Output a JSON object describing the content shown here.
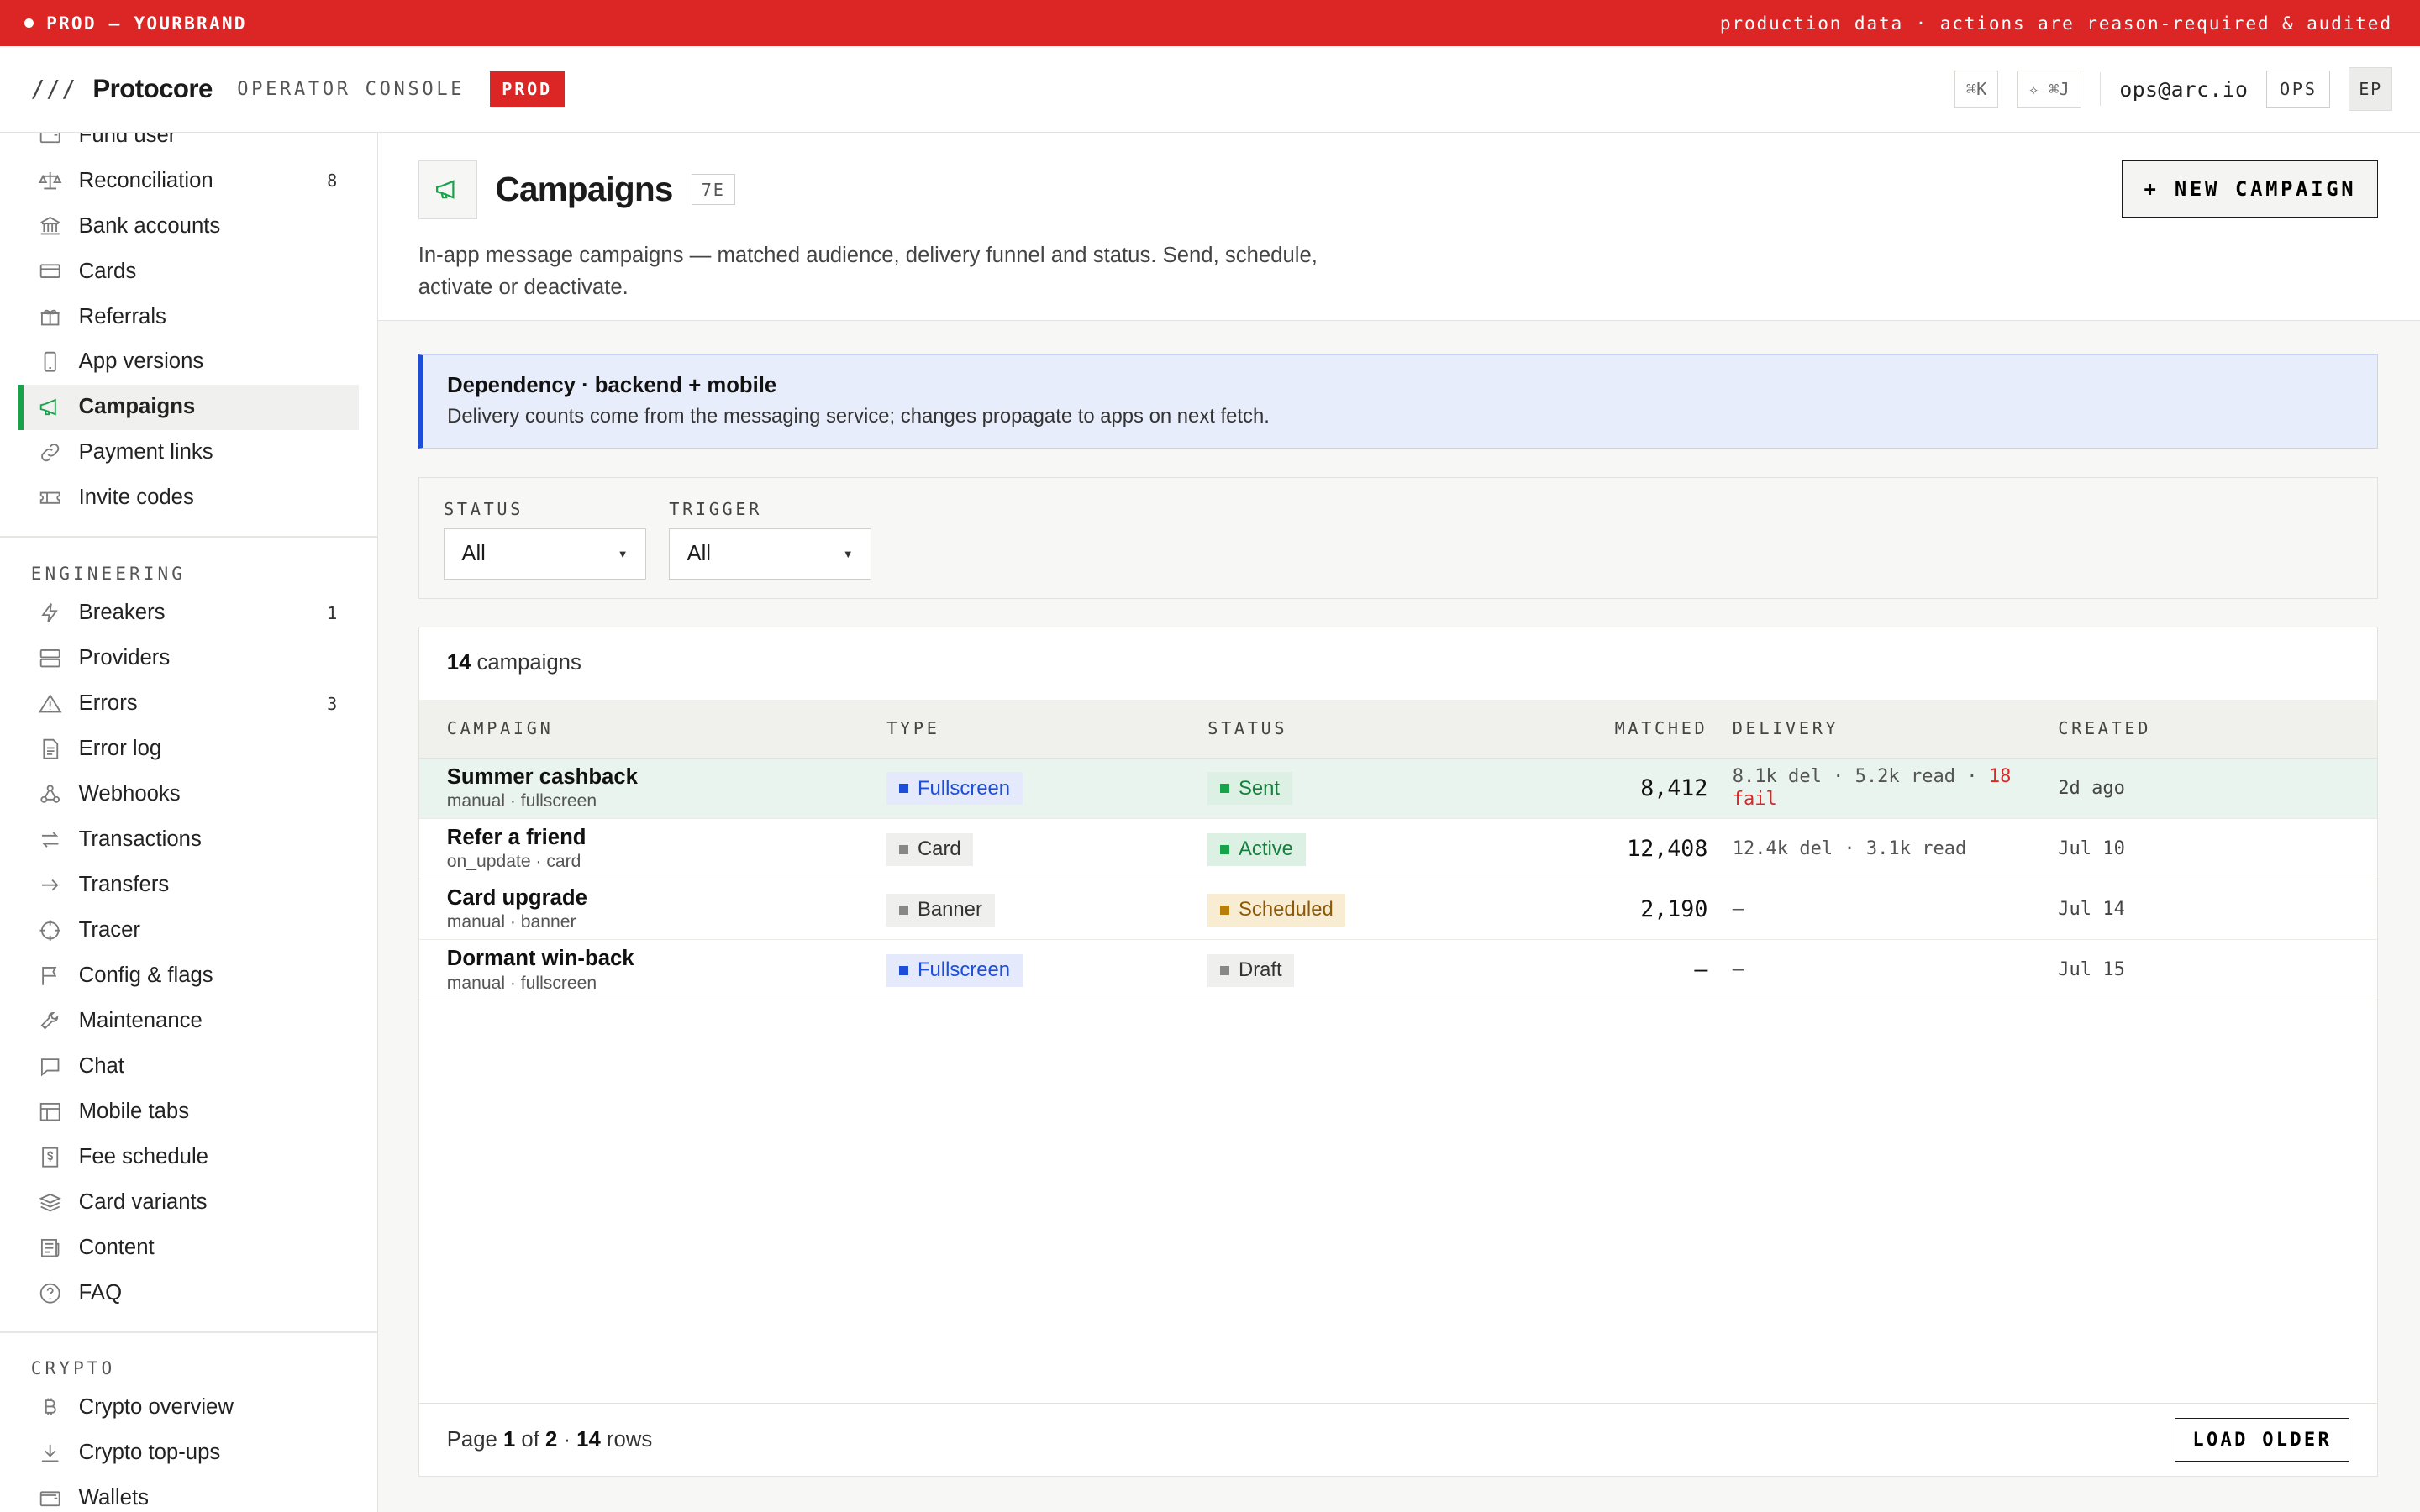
{
  "banner": {
    "left": "PROD — YOURBRAND",
    "right": "production data · actions are reason-required & audited"
  },
  "header": {
    "slashes": "///",
    "brand": "Protocore",
    "console": "OPERATOR CONSOLE",
    "env_pill": "PROD",
    "kbd_search": "⌘K",
    "kbd_jump": "✧ ⌘J",
    "email": "ops@arc.io",
    "role": "OPS",
    "avatar": "EP"
  },
  "sidebar": {
    "top_items": [
      {
        "label": "Fund user",
        "icon": "wallet-icon",
        "count": ""
      },
      {
        "label": "Reconciliation",
        "icon": "scale-icon",
        "count": "8"
      },
      {
        "label": "Bank accounts",
        "icon": "bank-icon",
        "count": ""
      },
      {
        "label": "Cards",
        "icon": "card-icon",
        "count": ""
      },
      {
        "label": "Referrals",
        "icon": "gift-icon",
        "count": ""
      },
      {
        "label": "App versions",
        "icon": "phone-icon",
        "count": ""
      },
      {
        "label": "Campaigns",
        "icon": "megaphone-icon",
        "count": ""
      },
      {
        "label": "Payment links",
        "icon": "link-icon",
        "count": ""
      },
      {
        "label": "Invite codes",
        "icon": "ticket-icon",
        "count": ""
      }
    ],
    "engineering_label": "ENGINEERING",
    "engineering_items": [
      {
        "label": "Breakers",
        "icon": "lightning-icon",
        "count": "1"
      },
      {
        "label": "Providers",
        "icon": "server-icon",
        "count": ""
      },
      {
        "label": "Errors",
        "icon": "warning-icon",
        "count": "3"
      },
      {
        "label": "Error log",
        "icon": "document-icon",
        "count": ""
      },
      {
        "label": "Webhooks",
        "icon": "webhook-icon",
        "count": ""
      },
      {
        "label": "Transactions",
        "icon": "arrows-icon",
        "count": ""
      },
      {
        "label": "Transfers",
        "icon": "arrow-right-icon",
        "count": ""
      },
      {
        "label": "Tracer",
        "icon": "crosshair-icon",
        "count": ""
      },
      {
        "label": "Config & flags",
        "icon": "flag-icon",
        "count": ""
      },
      {
        "label": "Maintenance",
        "icon": "wrench-icon",
        "count": ""
      },
      {
        "label": "Chat",
        "icon": "chat-icon",
        "count": ""
      },
      {
        "label": "Mobile tabs",
        "icon": "layout-icon",
        "count": ""
      },
      {
        "label": "Fee schedule",
        "icon": "dollar-icon",
        "count": ""
      },
      {
        "label": "Card variants",
        "icon": "layers-icon",
        "count": ""
      },
      {
        "label": "Content",
        "icon": "newspaper-icon",
        "count": ""
      },
      {
        "label": "FAQ",
        "icon": "help-icon",
        "count": ""
      }
    ],
    "crypto_label": "CRYPTO",
    "crypto_items": [
      {
        "label": "Crypto overview",
        "icon": "bitcoin-icon",
        "count": ""
      },
      {
        "label": "Crypto top-ups",
        "icon": "download-icon",
        "count": ""
      },
      {
        "label": "Wallets",
        "icon": "wallet-icon",
        "count": ""
      }
    ]
  },
  "page": {
    "title": "Campaigns",
    "tag": "7E",
    "description": "In-app message campaigns — matched audience, delivery funnel and status. Send, schedule, activate or deactivate.",
    "new_button": "NEW CAMPAIGN"
  },
  "dependency": {
    "title": "Dependency · backend + mobile",
    "text": "Delivery counts come from the messaging service; changes propagate to apps on next fetch."
  },
  "filters": {
    "status_label": "STATUS",
    "status_value": "All",
    "trigger_label": "TRIGGER",
    "trigger_value": "All"
  },
  "table": {
    "count": "14",
    "count_suffix": "campaigns",
    "headers": {
      "campaign": "CAMPAIGN",
      "type": "TYPE",
      "status": "STATUS",
      "matched": "MATCHED",
      "delivery": "DELIVERY",
      "created": "CREATED"
    },
    "rows": [
      {
        "name": "Summer cashback",
        "sub": "manual · fullscreen",
        "type": "Fullscreen",
        "status": "Sent",
        "matched": "8,412",
        "delivery": "8.1k del · 5.2k read · ",
        "delivery_fail": "18 fail",
        "created": "2d ago"
      },
      {
        "name": "Refer a friend",
        "sub": "on_update · card",
        "type": "Card",
        "status": "Active",
        "matched": "12,408",
        "delivery": "12.4k del · 3.1k read",
        "delivery_fail": "",
        "created": "Jul 10"
      },
      {
        "name": "Card upgrade",
        "sub": "manual · banner",
        "type": "Banner",
        "status": "Scheduled",
        "matched": "2,190",
        "delivery": "–",
        "delivery_fail": "",
        "created": "Jul 14"
      },
      {
        "name": "Dormant win-back",
        "sub": "manual · fullscreen",
        "type": "Fullscreen",
        "status": "Draft",
        "matched": "—",
        "delivery": "–",
        "delivery_fail": "",
        "created": "Jul 15"
      }
    ],
    "pager": {
      "page_word": "Page",
      "page": "1",
      "of_word": "of",
      "total": "2",
      "rows": "14",
      "rows_word": "rows"
    },
    "load_button": "LOAD OLDER"
  }
}
